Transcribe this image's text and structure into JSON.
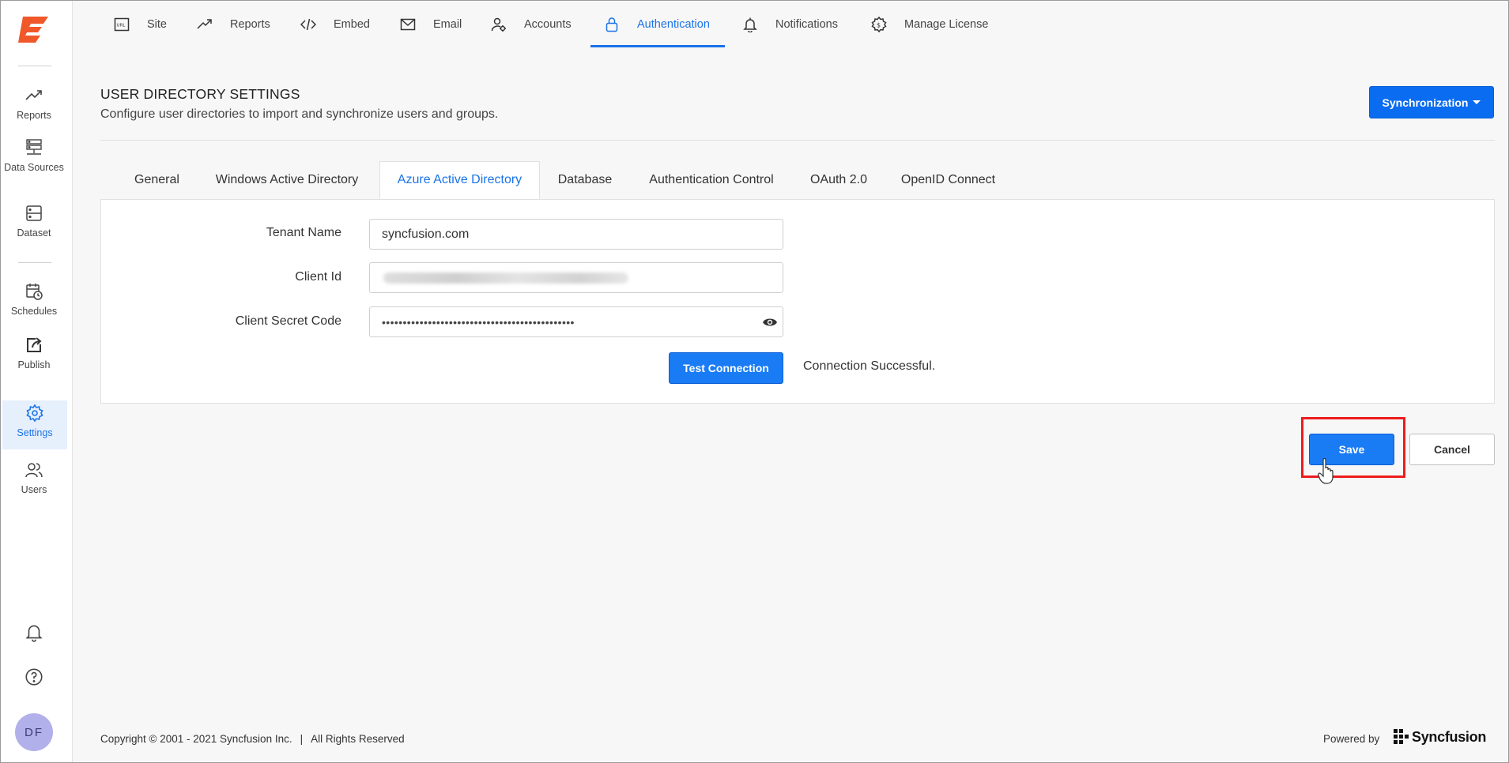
{
  "sidebar": {
    "items": [
      {
        "label": "Reports"
      },
      {
        "label": "Data Sources"
      },
      {
        "label": "Dataset"
      },
      {
        "label": "Schedules"
      },
      {
        "label": "Publish"
      },
      {
        "label": "Settings"
      },
      {
        "label": "Users"
      }
    ],
    "active": "Settings",
    "avatar_initials": "DF"
  },
  "topnav": {
    "items": [
      {
        "label": "Site",
        "icon": "url-icon"
      },
      {
        "label": "Reports",
        "icon": "trend-icon"
      },
      {
        "label": "Embed",
        "icon": "code-icon"
      },
      {
        "label": "Email",
        "icon": "mail-icon"
      },
      {
        "label": "Accounts",
        "icon": "user-gear-icon"
      },
      {
        "label": "Authentication",
        "icon": "lock-icon"
      },
      {
        "label": "Notifications",
        "icon": "bell-icon"
      },
      {
        "label": "Manage License",
        "icon": "license-gear-icon"
      }
    ],
    "active": "Authentication"
  },
  "header": {
    "title": "USER DIRECTORY SETTINGS",
    "subtitle": "Configure user directories to import and synchronize users and groups.",
    "sync_label": "Synchronization"
  },
  "subtabs": {
    "items": [
      "General",
      "Windows Active Directory",
      "Azure Active Directory",
      "Database",
      "Authentication Control",
      "OAuth 2.0",
      "OpenID Connect"
    ],
    "active": "Azure Active Directory"
  },
  "form": {
    "tenant_label": "Tenant Name",
    "tenant_value": "syncfusion.com",
    "client_id_label": "Client Id",
    "secret_label": "Client Secret Code",
    "secret_value": "••••••••••••••••••••••••••••••••••••••••••••••",
    "test_label": "Test Connection",
    "status": "Connection Successful."
  },
  "actions": {
    "save_label": "Save",
    "cancel_label": "Cancel"
  },
  "footer": {
    "copyright": "Copyright © 2001 - 2021 Syncfusion Inc.",
    "separator": "|",
    "rights": "All Rights Reserved",
    "powered_by": "Powered by",
    "brand": "Syncfusion"
  },
  "colors": {
    "accent": "#1a73e8",
    "button": "#1a7cf5",
    "logo": "#f0582a",
    "highlight": "#ee1c1c"
  }
}
